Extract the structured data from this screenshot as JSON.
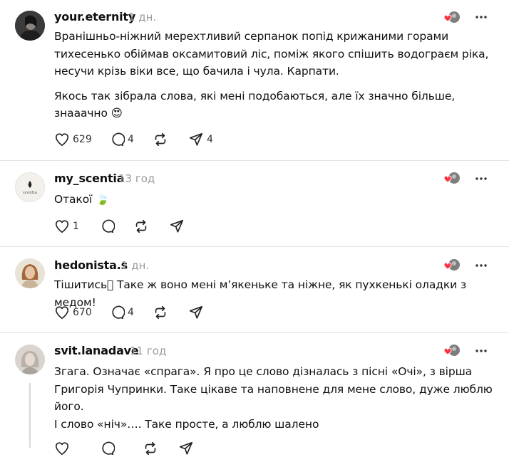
{
  "posts": [
    {
      "username": "your.eternity",
      "time": "1 дн.",
      "paragraphs": [
        "Вранішньо-ніжний мерехтливий серпанок попід крижаними горами тихесенько обіймав оксамитовий ліс, поміж якого спішить водограєм ріка, несучи крізь віки все, що бачила і чула. Карпати.",
        "Якось так зібрала слова, які мені подобаються, але їх значно більше, знааачно 😍"
      ],
      "likes": "629",
      "replies": "4",
      "reposts": "",
      "shares": "4"
    },
    {
      "username": "my_scentia",
      "time": "13 год",
      "avatar_text": "scentia",
      "paragraphs": [
        "Отакої 🍃"
      ],
      "likes": "1",
      "replies": "",
      "reposts": "",
      "shares": ""
    },
    {
      "username": "hedonista.s",
      "time": "1 дн.",
      "paragraphs": [
        "Тішитись􏿽 Таке ж воно мені м’якеньке та ніжне, як пухкенькі оладки з медом!"
      ],
      "likes": "670",
      "replies": "4",
      "reposts": "",
      "shares": ""
    },
    {
      "username": "svit.lanadave",
      "time": "11 год",
      "paragraphs": [
        "Згага. Означає «спрага». Я про це слово дізналась з пісні «Очі», з вірша Григорія Чупринки. Таке цікаве та наповнене для мене слово, дуже люблю його.",
        "І слово «ніч»…. Таке просте, а люблю шалено"
      ],
      "likes": "",
      "replies": "",
      "reposts": "",
      "shares": ""
    }
  ],
  "colors": {
    "text": "#101010",
    "muted": "#9a9a9a",
    "like_heart": "#ff3040",
    "separator": "#e3e3e3"
  }
}
